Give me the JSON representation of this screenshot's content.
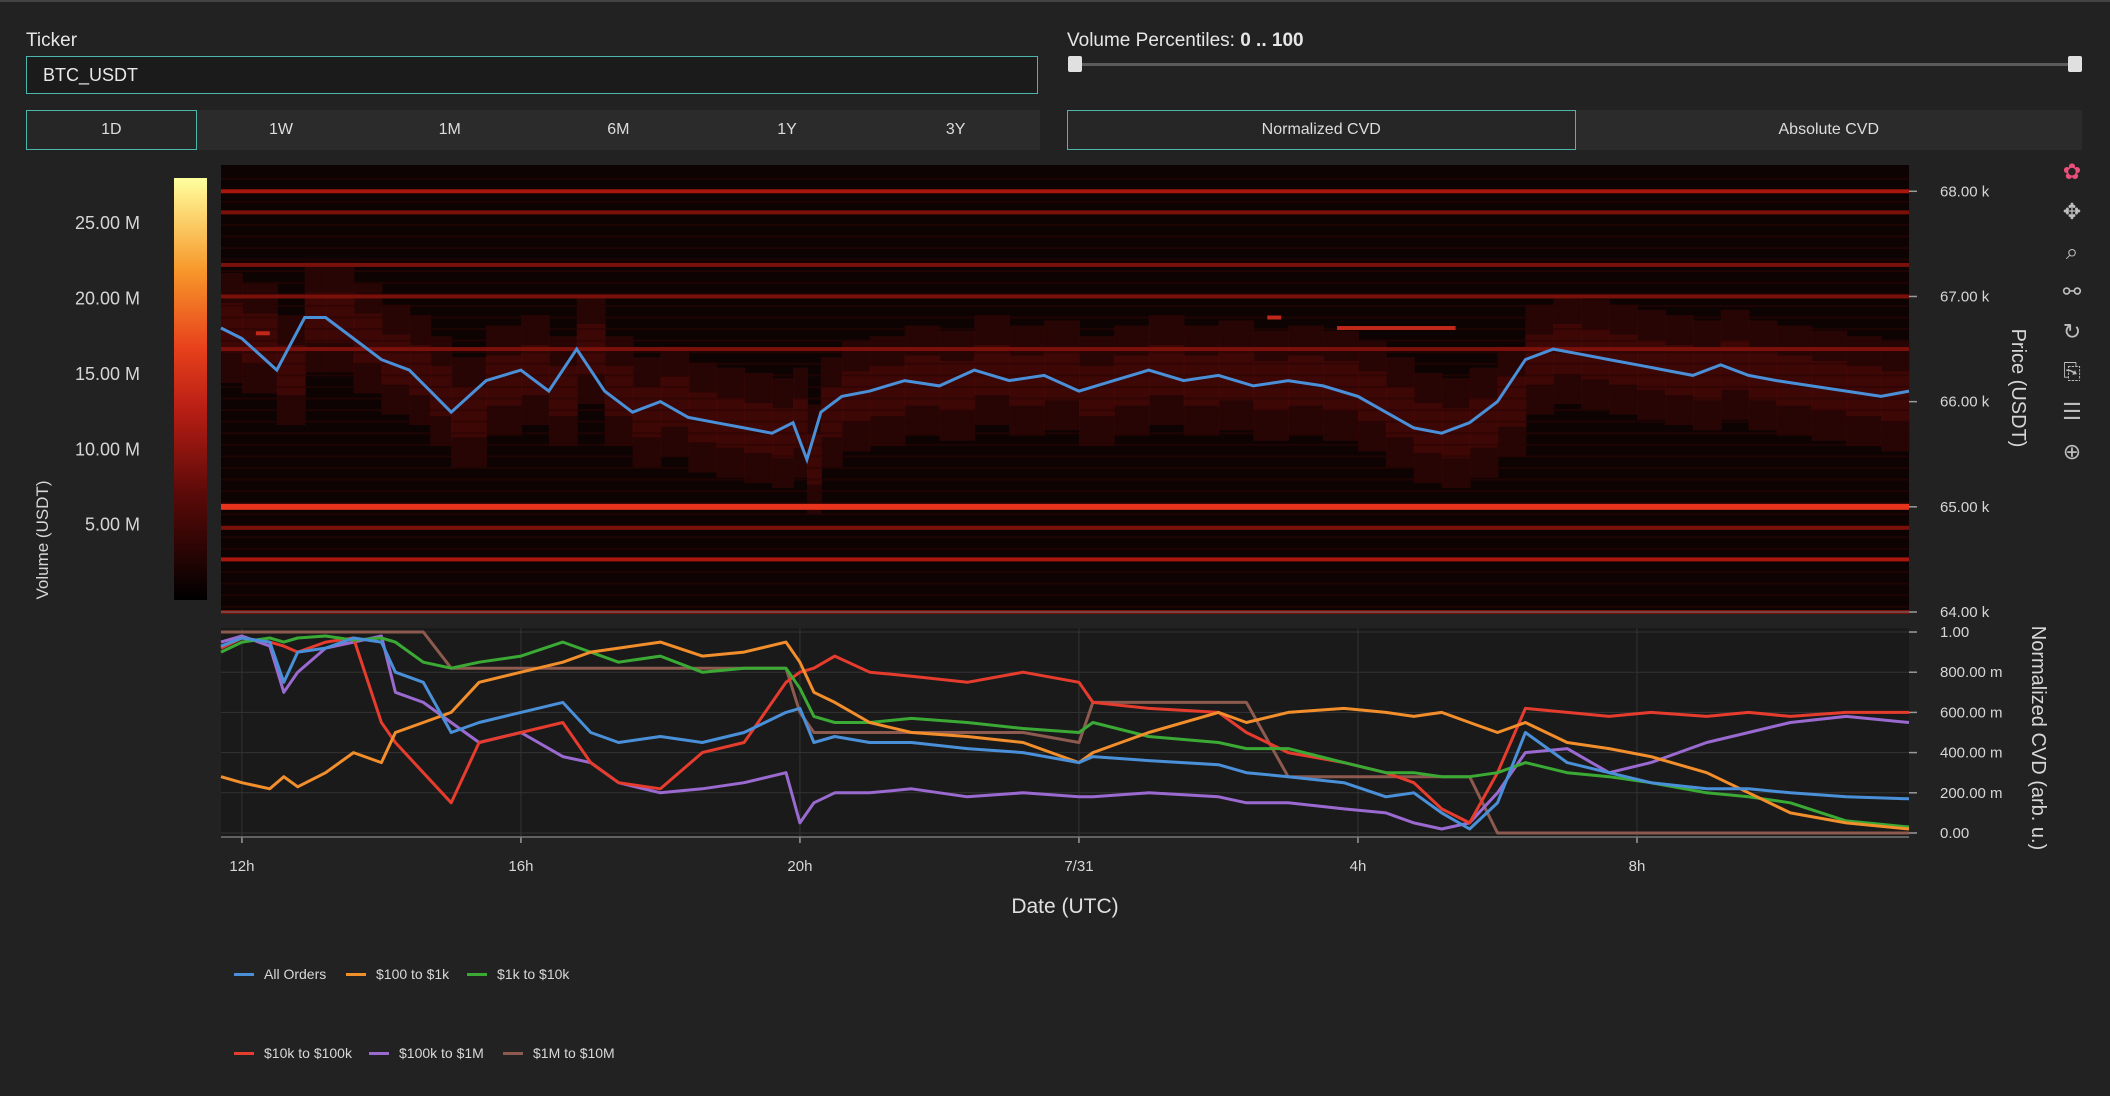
{
  "ticker": {
    "label": "Ticker",
    "value": "BTC_USDT"
  },
  "volume_percentiles": {
    "label": "Volume Percentiles:",
    "range_text": "0 .. 100",
    "min": 0,
    "max": 100,
    "low": 0,
    "high": 100
  },
  "timeframes": [
    {
      "label": "1D",
      "active": true
    },
    {
      "label": "1W",
      "active": false
    },
    {
      "label": "1M",
      "active": false
    },
    {
      "label": "6M",
      "active": false
    },
    {
      "label": "1Y",
      "active": false
    },
    {
      "label": "3Y",
      "active": false
    }
  ],
  "cvd_modes": [
    {
      "label": "Normalized CVD",
      "active": true
    },
    {
      "label": "Absolute CVD",
      "active": false
    }
  ],
  "modebar_icons": [
    "plotly-logo-icon",
    "pan-icon",
    "zoom-icon",
    "spikelines-icon",
    "reset-axes-icon",
    "download-icon",
    "hover-compare-icon",
    "hover-closest-icon"
  ],
  "colors": {
    "accent": "#4db6ac",
    "all_orders": "#4a90d9",
    "usd100_1k": "#f28e2b",
    "usd1k_10k": "#3aaa35",
    "usd10k_100k": "#e63c2e",
    "usd100k_1m": "#9a6ad0",
    "usd1m_10m": "#8c5a4e"
  },
  "chart_data": [
    {
      "type": "heatmap",
      "title": "",
      "ylabel": "Price (USDT)",
      "colorbar_label": "Volume (USDT)",
      "colorbar_ticks": [
        "25.00 M",
        "20.00 M",
        "15.00 M",
        "10.00 M",
        "5.00 M"
      ],
      "colorbar_tick_values": [
        25,
        20,
        15,
        10,
        5
      ],
      "colorbar_range": [
        0,
        28
      ],
      "y_ticks": [
        "68.00 k",
        "67.00 k",
        "66.00 k",
        "65.00 k",
        "64.00 k"
      ],
      "y_tick_values": [
        68000,
        67000,
        66000,
        65000,
        64000
      ],
      "ylim": [
        64000,
        68250
      ],
      "xlim": [
        11.7,
        35.9
      ],
      "x_ticks": [
        "12h",
        "16h",
        "20h",
        "7/31",
        "4h",
        "8h"
      ],
      "x_tick_values": [
        12,
        16,
        20,
        24,
        28,
        32
      ],
      "price_series": {
        "name": "Price",
        "x": [
          11.7,
          12.0,
          12.5,
          12.9,
          13.2,
          13.6,
          14.0,
          14.4,
          14.7,
          15.0,
          15.5,
          16.0,
          16.4,
          16.8,
          17.2,
          17.6,
          18.0,
          18.4,
          18.8,
          19.2,
          19.6,
          19.9,
          20.1,
          20.3,
          20.6,
          21.0,
          21.5,
          22.0,
          22.5,
          23.0,
          23.5,
          24.0,
          24.5,
          25.0,
          25.5,
          26.0,
          26.5,
          27.0,
          27.5,
          28.0,
          28.4,
          28.8,
          29.2,
          29.6,
          30.0,
          30.4,
          30.8,
          31.2,
          31.6,
          32.0,
          32.4,
          32.8,
          33.2,
          33.6,
          34.0,
          34.5,
          35.0,
          35.5,
          35.9
        ],
        "y": [
          66700,
          66600,
          66300,
          66800,
          66800,
          66600,
          66400,
          66300,
          66100,
          65900,
          66200,
          66300,
          66100,
          66500,
          66100,
          65900,
          66000,
          65850,
          65800,
          65750,
          65700,
          65800,
          65450,
          65900,
          66050,
          66100,
          66200,
          66150,
          66300,
          66200,
          66250,
          66100,
          66200,
          66300,
          66200,
          66250,
          66150,
          66200,
          66150,
          66050,
          65900,
          65750,
          65700,
          65800,
          66000,
          66400,
          66500,
          66450,
          66400,
          66350,
          66300,
          66250,
          66350,
          66250,
          66200,
          66150,
          66100,
          66050,
          66100
        ]
      },
      "price_levels": [
        {
          "price": 68000,
          "intensity": 0.55
        },
        {
          "price": 67800,
          "intensity": 0.35
        },
        {
          "price": 67300,
          "intensity": 0.35
        },
        {
          "price": 67000,
          "intensity": 0.4
        },
        {
          "price": 66500,
          "intensity": 0.3
        },
        {
          "price": 65000,
          "intensity": 0.95
        },
        {
          "price": 64800,
          "intensity": 0.4
        },
        {
          "price": 64500,
          "intensity": 0.6
        },
        {
          "price": 64000,
          "intensity": 0.5
        }
      ],
      "annotations": [
        {
          "x0": 12.2,
          "x1": 12.4,
          "price": 66650
        },
        {
          "x0": 26.7,
          "x1": 26.9,
          "price": 66800
        },
        {
          "x0": 27.7,
          "x1": 29.4,
          "price": 66700
        }
      ]
    },
    {
      "type": "line",
      "title": "",
      "xlabel": "Date (UTC)",
      "ylabel": "Normalized CVD (arb. u.)",
      "xlim": [
        11.7,
        35.9
      ],
      "ylim": [
        -0.02,
        1.02
      ],
      "x_ticks": [
        "12h",
        "16h",
        "20h",
        "7/31",
        "4h",
        "8h"
      ],
      "x_tick_values": [
        12,
        16,
        20,
        24,
        28,
        32
      ],
      "y_ticks": [
        "1.00",
        "800.00 m",
        "600.00 m",
        "400.00 m",
        "200.00 m",
        "0.00"
      ],
      "y_tick_values": [
        1,
        0.8,
        0.6,
        0.4,
        0.2,
        0
      ],
      "legend_position": "bottom-left",
      "x": [
        11.7,
        12.0,
        12.4,
        12.6,
        12.8,
        13.2,
        13.6,
        14.0,
        14.2,
        14.6,
        15.0,
        15.4,
        16.0,
        16.6,
        17.0,
        17.4,
        18.0,
        18.6,
        19.2,
        19.8,
        20.0,
        20.2,
        20.5,
        21.0,
        21.6,
        22.4,
        23.2,
        24.0,
        24.2,
        25.0,
        26.0,
        26.4,
        27.0,
        27.8,
        28.4,
        28.8,
        29.2,
        29.6,
        30.0,
        30.4,
        31.0,
        31.6,
        32.2,
        33.0,
        33.6,
        34.2,
        35.0,
        35.9
      ],
      "series": [
        {
          "name": "All Orders",
          "values": [
            0.93,
            0.97,
            0.95,
            0.75,
            0.9,
            0.92,
            0.97,
            0.95,
            0.8,
            0.75,
            0.5,
            0.55,
            0.6,
            0.65,
            0.5,
            0.45,
            0.48,
            0.45,
            0.5,
            0.6,
            0.62,
            0.45,
            0.48,
            0.45,
            0.45,
            0.42,
            0.4,
            0.35,
            0.38,
            0.36,
            0.34,
            0.3,
            0.28,
            0.25,
            0.18,
            0.2,
            0.1,
            0.02,
            0.15,
            0.5,
            0.35,
            0.3,
            0.25,
            0.22,
            0.22,
            0.2,
            0.18,
            0.17
          ]
        },
        {
          "name": "$100 to $1k",
          "values": [
            0.28,
            0.25,
            0.22,
            0.28,
            0.23,
            0.3,
            0.4,
            0.35,
            0.5,
            0.55,
            0.6,
            0.75,
            0.8,
            0.85,
            0.9,
            0.92,
            0.95,
            0.88,
            0.9,
            0.95,
            0.85,
            0.7,
            0.65,
            0.55,
            0.5,
            0.48,
            0.45,
            0.35,
            0.4,
            0.5,
            0.6,
            0.55,
            0.6,
            0.62,
            0.6,
            0.58,
            0.6,
            0.55,
            0.5,
            0.55,
            0.45,
            0.42,
            0.38,
            0.3,
            0.2,
            0.1,
            0.05,
            0.02
          ]
        },
        {
          "name": "$1k to $10k",
          "values": [
            0.9,
            0.95,
            0.97,
            0.95,
            0.97,
            0.98,
            0.96,
            0.97,
            0.95,
            0.85,
            0.82,
            0.85,
            0.88,
            0.95,
            0.9,
            0.85,
            0.88,
            0.8,
            0.82,
            0.82,
            0.72,
            0.58,
            0.55,
            0.55,
            0.57,
            0.55,
            0.52,
            0.5,
            0.55,
            0.48,
            0.45,
            0.42,
            0.42,
            0.35,
            0.3,
            0.3,
            0.28,
            0.28,
            0.3,
            0.35,
            0.3,
            0.28,
            0.25,
            0.2,
            0.18,
            0.15,
            0.06,
            0.03
          ]
        },
        {
          "name": "$10k to $100k",
          "values": [
            0.92,
            0.97,
            0.95,
            0.93,
            0.9,
            0.95,
            0.97,
            0.55,
            0.45,
            0.3,
            0.15,
            0.45,
            0.5,
            0.55,
            0.35,
            0.25,
            0.22,
            0.4,
            0.45,
            0.75,
            0.8,
            0.82,
            0.88,
            0.8,
            0.78,
            0.75,
            0.8,
            0.75,
            0.65,
            0.62,
            0.6,
            0.5,
            0.4,
            0.35,
            0.3,
            0.25,
            0.12,
            0.05,
            0.3,
            0.62,
            0.6,
            0.58,
            0.6,
            0.58,
            0.6,
            0.58,
            0.6,
            0.6
          ]
        },
        {
          "name": "$100k to $1M",
          "values": [
            0.95,
            0.98,
            0.93,
            0.7,
            0.8,
            0.92,
            0.95,
            0.98,
            0.7,
            0.65,
            0.55,
            0.45,
            0.5,
            0.38,
            0.35,
            0.25,
            0.2,
            0.22,
            0.25,
            0.3,
            0.05,
            0.15,
            0.2,
            0.2,
            0.22,
            0.18,
            0.2,
            0.18,
            0.18,
            0.2,
            0.18,
            0.15,
            0.15,
            0.12,
            0.1,
            0.05,
            0.02,
            0.05,
            0.2,
            0.4,
            0.42,
            0.3,
            0.35,
            0.45,
            0.5,
            0.55,
            0.58,
            0.55
          ]
        },
        {
          "name": "$1M to $10M",
          "values": [
            1.0,
            1.0,
            1.0,
            1.0,
            1.0,
            1.0,
            1.0,
            1.0,
            1.0,
            1.0,
            0.82,
            0.82,
            0.82,
            0.82,
            0.82,
            0.82,
            0.82,
            0.82,
            0.82,
            0.82,
            0.6,
            0.5,
            0.5,
            0.5,
            0.5,
            0.5,
            0.5,
            0.45,
            0.65,
            0.65,
            0.65,
            0.65,
            0.28,
            0.28,
            0.28,
            0.28,
            0.28,
            0.28,
            0.0,
            0.0,
            0.0,
            0.0,
            0.0,
            0.0,
            0.0,
            0.0,
            0.0,
            0.0
          ]
        }
      ]
    }
  ]
}
